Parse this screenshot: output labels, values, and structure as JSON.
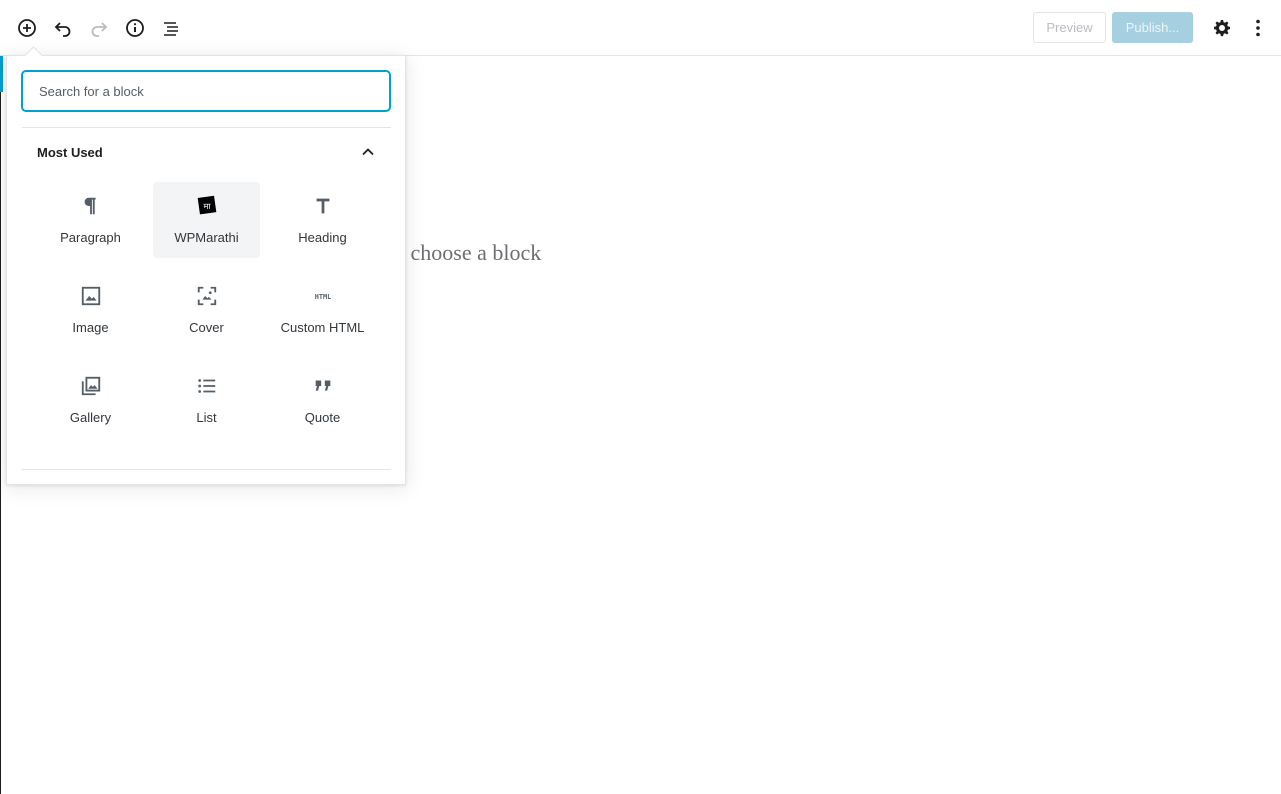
{
  "toolbar": {
    "preview_label": "Preview",
    "publish_label": "Publish..."
  },
  "canvas": {
    "placeholder": "o choose a block"
  },
  "inserter": {
    "search_placeholder": "Search for a block",
    "panel_title": "Most Used",
    "blocks": [
      {
        "label": "Paragraph",
        "icon": "paragraph-icon"
      },
      {
        "label": "WPMarathi",
        "icon": "wpmarathi-icon"
      },
      {
        "label": "Heading",
        "icon": "heading-icon"
      },
      {
        "label": "Image",
        "icon": "image-icon"
      },
      {
        "label": "Cover",
        "icon": "cover-icon"
      },
      {
        "label": "Custom HTML",
        "icon": "html-icon"
      },
      {
        "label": "Gallery",
        "icon": "gallery-icon"
      },
      {
        "label": "List",
        "icon": "list-icon"
      },
      {
        "label": "Quote",
        "icon": "quote-icon"
      }
    ],
    "wpmarathi_glyph": "मा"
  },
  "colors": {
    "accent": "#00a0d2",
    "publish_bg": "#a6cfe0"
  }
}
